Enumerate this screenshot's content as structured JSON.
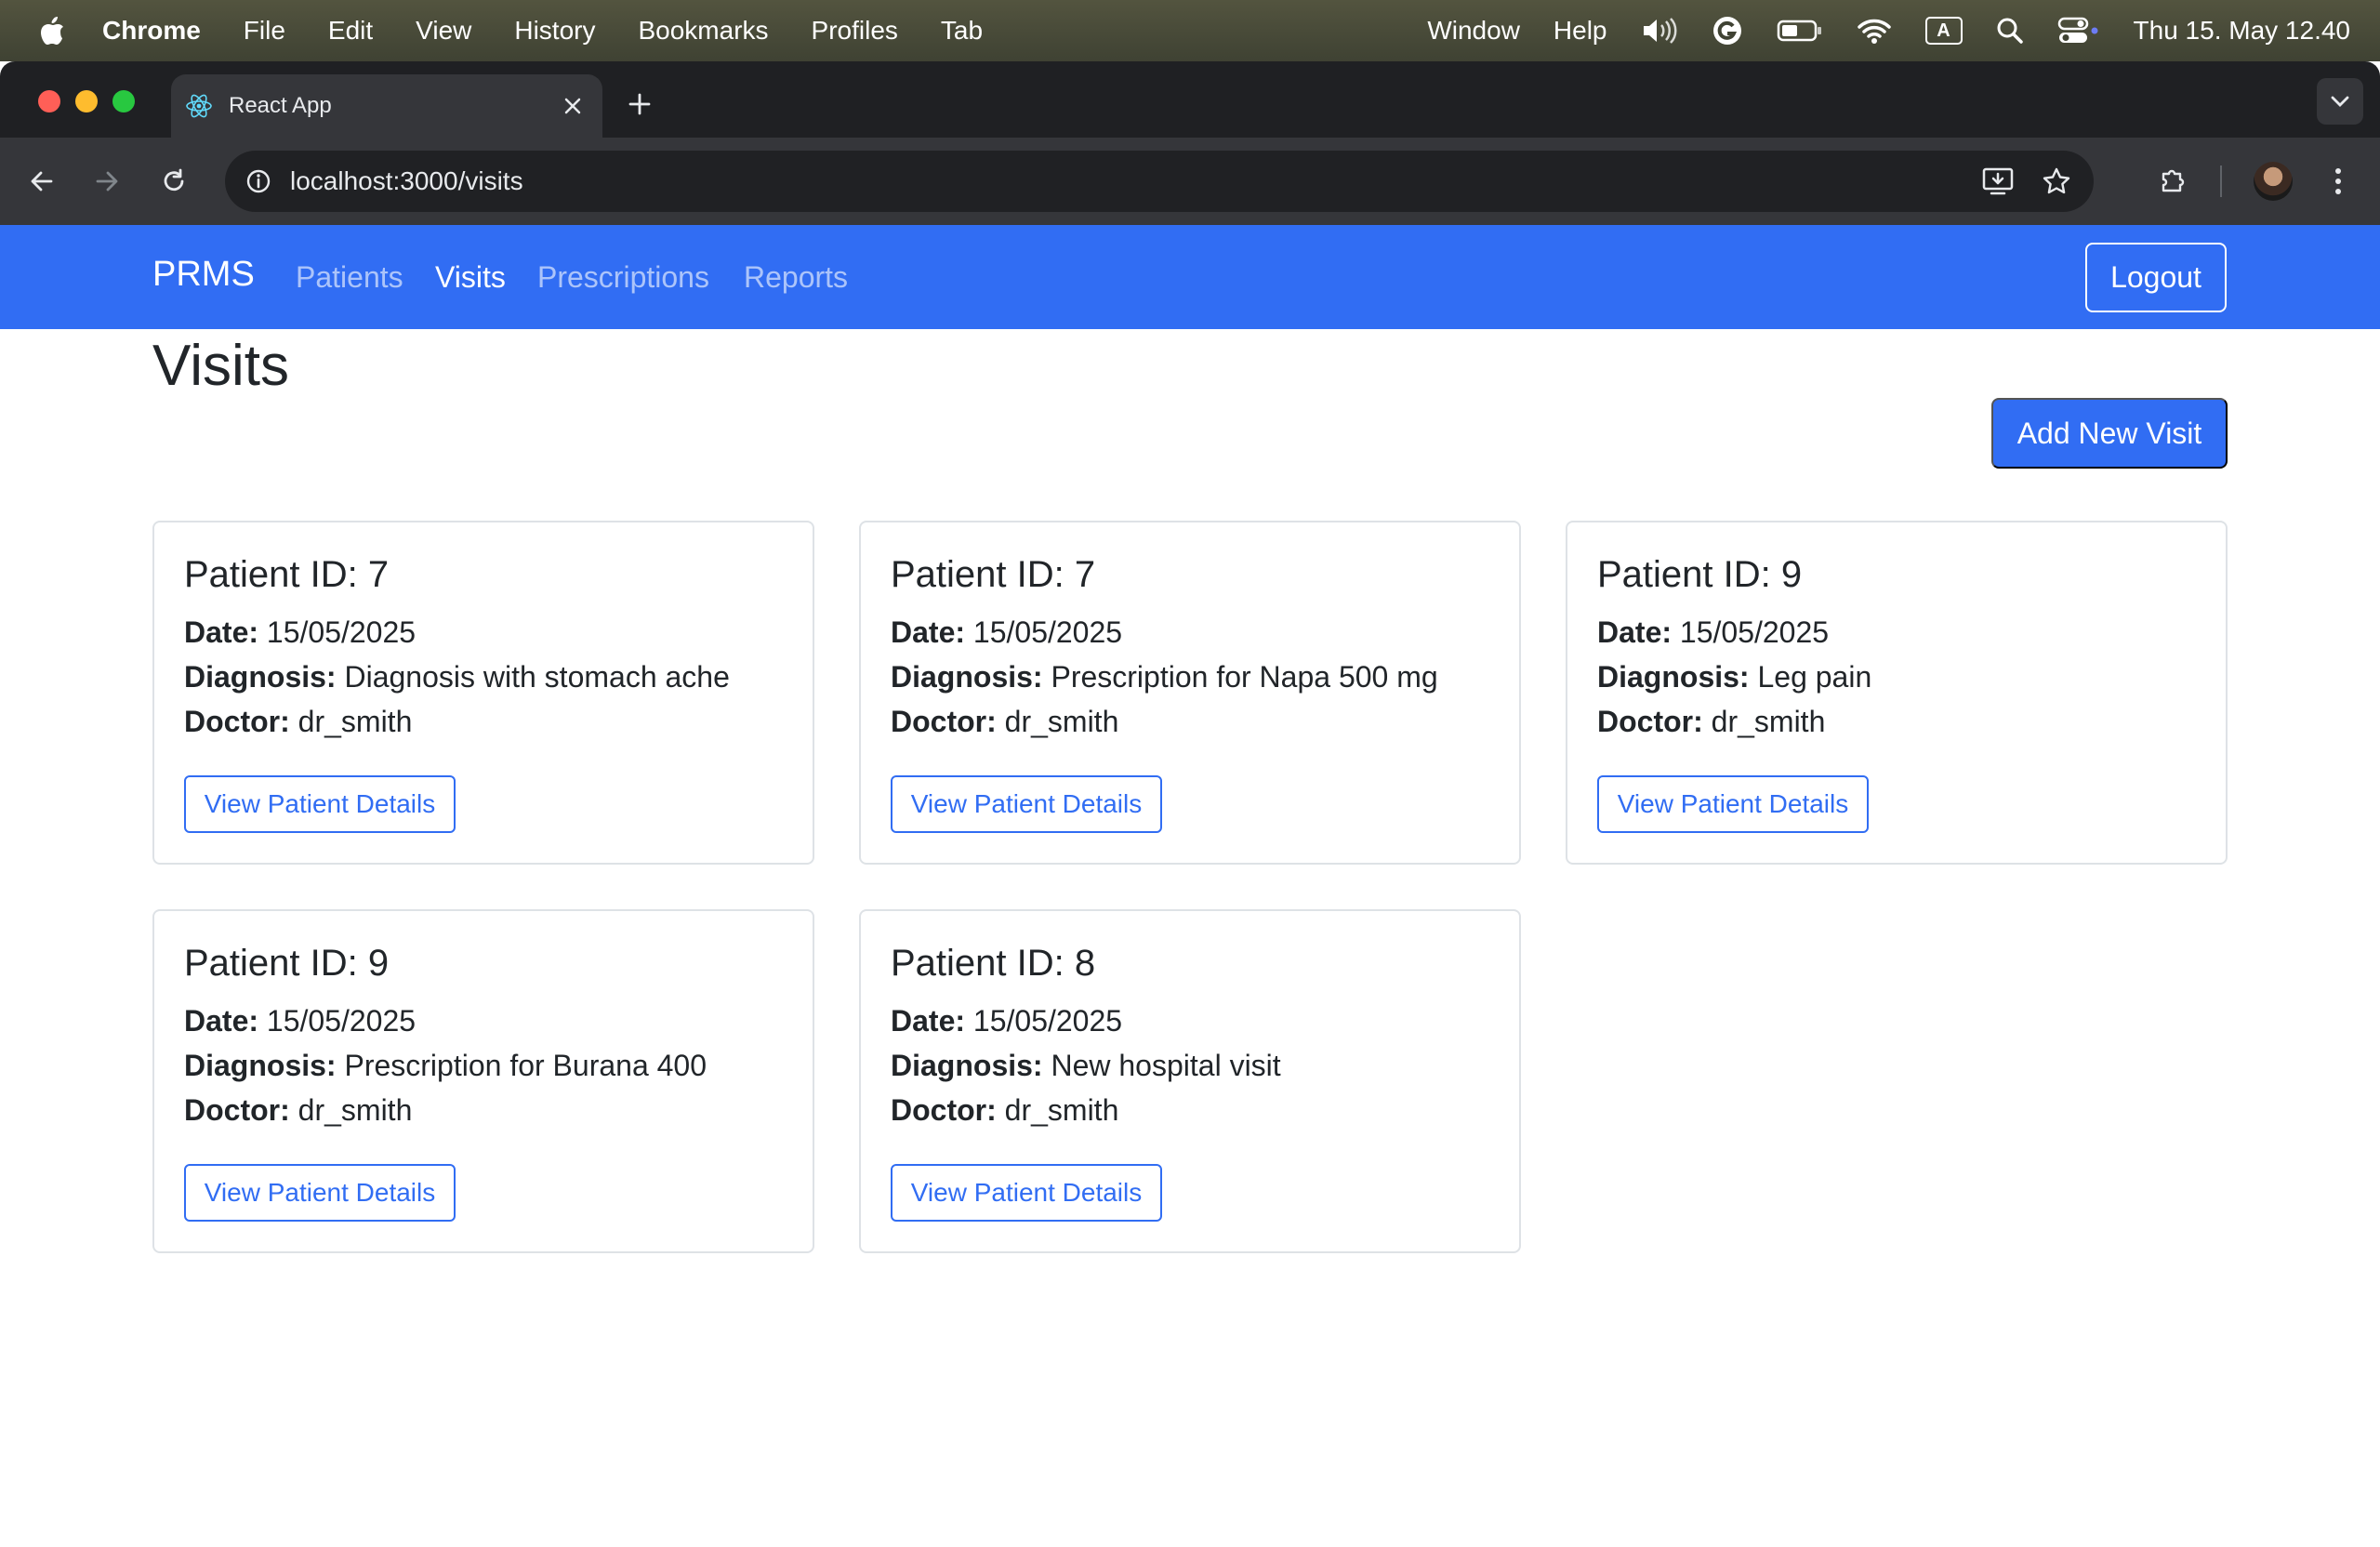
{
  "menubar": {
    "app": "Chrome",
    "items": [
      "File",
      "Edit",
      "View",
      "History",
      "Bookmarks",
      "Profiles",
      "Tab",
      "Window",
      "Help"
    ],
    "clock": "Thu 15. May  12.40"
  },
  "browser": {
    "tab_title": "React App",
    "url": "localhost:3000/visits"
  },
  "navbar": {
    "brand": "PRMS",
    "links": [
      "Patients",
      "Visits",
      "Prescriptions",
      "Reports"
    ],
    "active": "Visits",
    "logout_label": "Logout"
  },
  "main": {
    "title": "Visits",
    "add_button_label": "Add New Visit",
    "labels": {
      "date": "Date:",
      "diagnosis": "Diagnosis:",
      "doctor": "Doctor:"
    },
    "view_button_label": "View Patient Details",
    "visits": [
      {
        "patient": "Patient ID: 7",
        "date": "15/05/2025",
        "diagnosis": "Diagnosis with stomach ache",
        "doctor": "dr_smith"
      },
      {
        "patient": "Patient ID: 7",
        "date": "15/05/2025",
        "diagnosis": "Prescription for Napa 500 mg",
        "doctor": "dr_smith"
      },
      {
        "patient": "Patient ID: 9",
        "date": "15/05/2025",
        "diagnosis": "Leg pain",
        "doctor": "dr_smith"
      },
      {
        "patient": "Patient ID: 9",
        "date": "15/05/2025",
        "diagnosis": "Prescription for Burana 400",
        "doctor": "dr_smith"
      },
      {
        "patient": "Patient ID: 8",
        "date": "15/05/2025",
        "diagnosis": "New hospital visit",
        "doctor": "dr_smith"
      }
    ]
  },
  "colors": {
    "primary": "#316df3",
    "text": "#212529",
    "card_border": "#dee2e6"
  }
}
